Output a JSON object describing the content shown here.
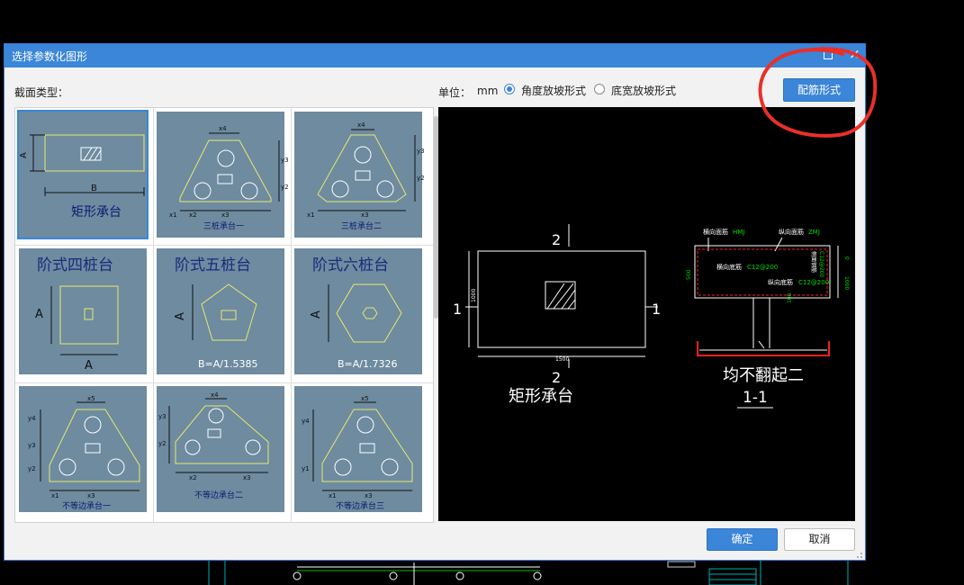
{
  "dialog": {
    "title": "选择参数化图形",
    "close_glyph": "×",
    "section_label": "截面类型：",
    "unit_label": "单位：",
    "unit_value": "mm",
    "radio_angle_label": "角度放坡形式",
    "radio_width_label": "底宽放坡形式",
    "rebar_button": "配筋形式",
    "ok_button": "确定",
    "cancel_button": "取消"
  },
  "gallery": {
    "items": [
      {
        "label": "矩形承台",
        "selected": true
      },
      {
        "label": "三桩承台一"
      },
      {
        "label": "三桩承台二"
      },
      {
        "label": "阶式四桩台"
      },
      {
        "label": "阶式五桩台",
        "formula": "B=A/1.5385"
      },
      {
        "label": "阶式六桩台",
        "formula": "B=A/1.7326"
      },
      {
        "label": "不等边承台一"
      },
      {
        "label": "不等边承台二"
      },
      {
        "label": "不等边承台三"
      }
    ],
    "dims": {
      "A": "A",
      "B": "B",
      "x1": "x1",
      "x2": "x2",
      "x3": "x3",
      "x4": "x4",
      "x5": "x5",
      "y1": "y1",
      "y2": "y2",
      "y3": "y3",
      "y4": "y4"
    }
  },
  "preview": {
    "section_no": "2",
    "side_no": "1",
    "height_dim": "1000",
    "width_dim": "1500",
    "plan_title": "矩形承台",
    "top_label_x": "横向面筋",
    "top_label_x_code": "HMJ",
    "top_label_y": "纵向面筋",
    "top_label_y_code": "ZMJ",
    "bottom_label_x": "横向底筋",
    "bottom_label_x_code": "C12@200",
    "bottom_label_y": "纵向底筋",
    "bottom_label_y_code": "C12@200",
    "side_label": "侧面钢筋",
    "side_label_code": "C12@200",
    "depth_dim": "500",
    "cover_dim": "0",
    "right_dim": "1000",
    "left_inner_dim": "100",
    "note": "均不翻起二",
    "section_title": "1-1"
  },
  "colors": {
    "accent": "#3b86d8",
    "thumb_bg": "#6e8ba0",
    "shape_yellow": "#e8e86a",
    "cad_green": "#00e000",
    "cad_red": "#ff2020",
    "annotation_red": "#e8302a"
  }
}
